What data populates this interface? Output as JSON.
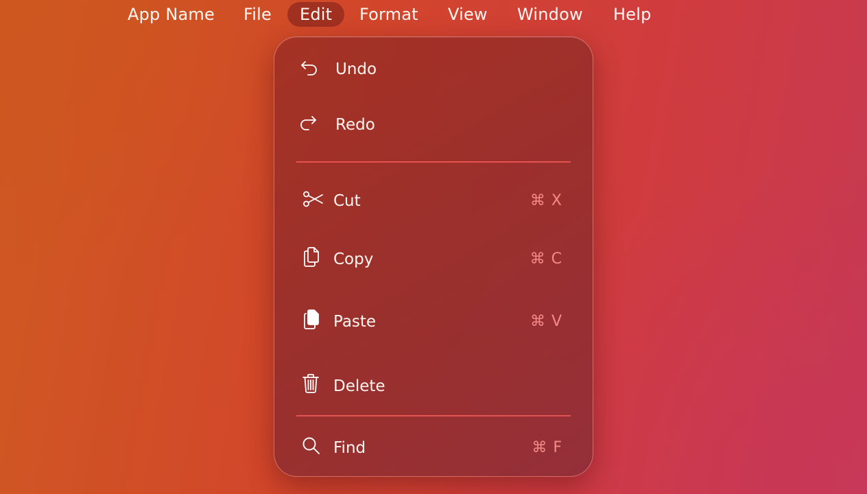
{
  "menubar": {
    "app_name": "App Name",
    "file": "File",
    "edit": "Edit",
    "format": "Format",
    "view": "View",
    "window": "Window",
    "help": "Help"
  },
  "edit_menu": {
    "undo": {
      "label": "Undo",
      "icon": "undo-arrow-icon"
    },
    "redo": {
      "label": "Redo",
      "icon": "redo-arrow-icon"
    },
    "cut": {
      "label": "Cut",
      "shortcut": "⌘ X",
      "icon": "scissors-icon"
    },
    "copy": {
      "label": "Copy",
      "shortcut": "⌘ C",
      "icon": "copy-documents-icon"
    },
    "paste": {
      "label": "Paste",
      "shortcut": "⌘ V",
      "icon": "paste-documents-icon"
    },
    "delete": {
      "label": "Delete",
      "icon": "trash-icon"
    },
    "find": {
      "label": "Find",
      "shortcut": "⌘ F",
      "icon": "magnifier-icon"
    }
  },
  "colors": {
    "background_start": "#cf5a22",
    "background_end": "#c63952",
    "menu_background": "#932d2d",
    "divider": "#ff5f5f",
    "shortcut_text": "#ff9691",
    "active_menu_pill": "#781e19"
  }
}
